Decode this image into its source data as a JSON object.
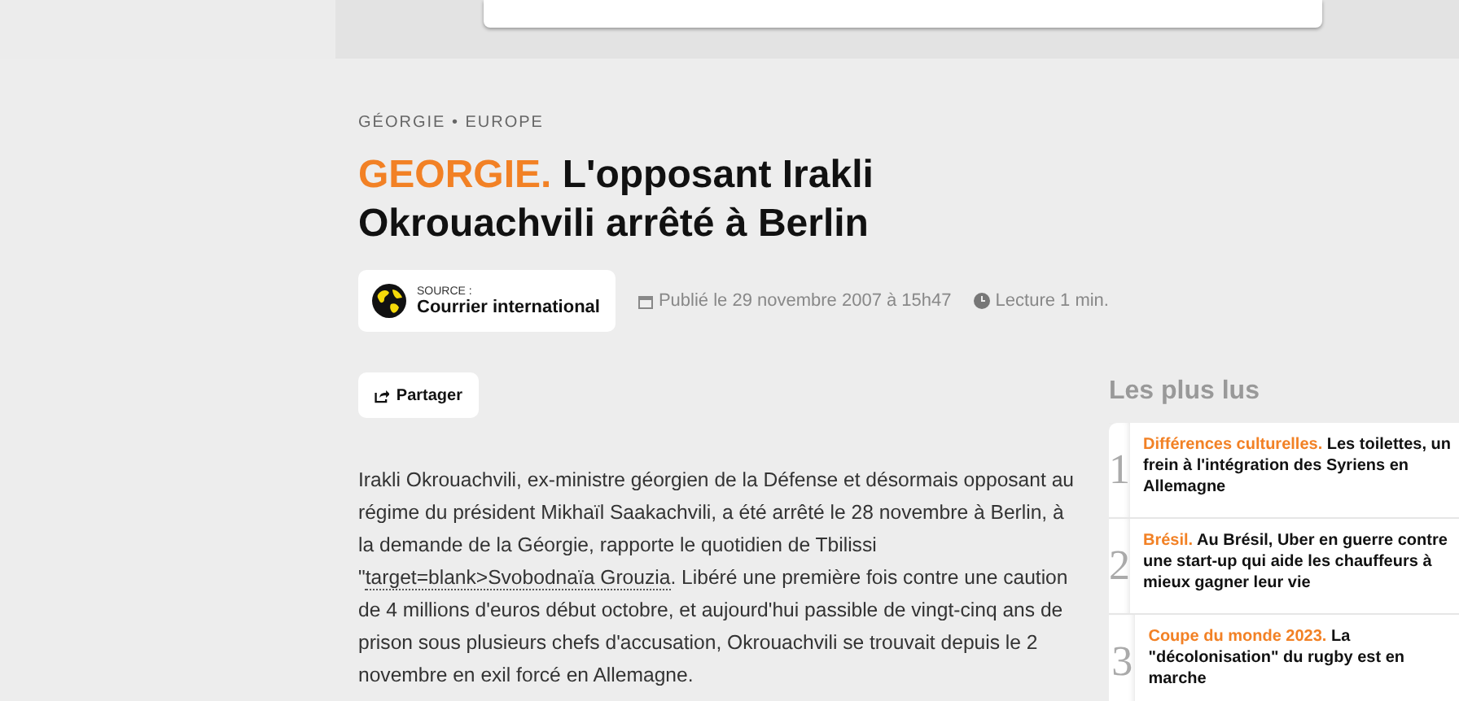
{
  "breadcrumb": "GÉORGIE • EUROPE",
  "title": {
    "kicker": "GEORGIE.",
    "text": "L'opposant Irakli Okrouachvili arrêté à Berlin"
  },
  "source": {
    "label": "SOURCE :",
    "name": "Courrier international"
  },
  "published": "Publié le 29 novembre 2007 à 15h47",
  "reading_time": "Lecture 1 min.",
  "share_button": "Partager",
  "paragraph": {
    "before": "Irakli Okrouachvili, ex-ministre géorgien de la Défense et désormais opposant au régime du président Mikhaïl Saakachvili, a été arrêté le 28 novembre à Berlin, à la demande de la Géorgie, rapporte le quotidien de Tbilissi \"",
    "link": "target=blank>Svobodnaïa Grouzia",
    "after": ". Libéré une première fois contre une caution de 4 millions d'euros début octobre, et aujourd'hui passible de vingt-cinq ans de prison sous plusieurs chefs d'accusation, Okrouachvili se trouvait depuis le 2 novembre en exil forcé en Allemagne."
  },
  "most_read": {
    "heading": "Les plus lus",
    "items": [
      {
        "rank": "1",
        "kicker": "Différences culturelles.",
        "text": "Les toilettes, un frein à l'intégration des Syriens en Allemagne"
      },
      {
        "rank": "2",
        "kicker": "Brésil.",
        "text": "Au Brésil, Uber en guerre contre une start-up qui aide les chauffeurs à mieux gagner leur vie"
      },
      {
        "rank": "3",
        "kicker": "Coupe du monde 2023.",
        "text": "La \"décolonisation\" du rugby est en marche"
      }
    ]
  }
}
